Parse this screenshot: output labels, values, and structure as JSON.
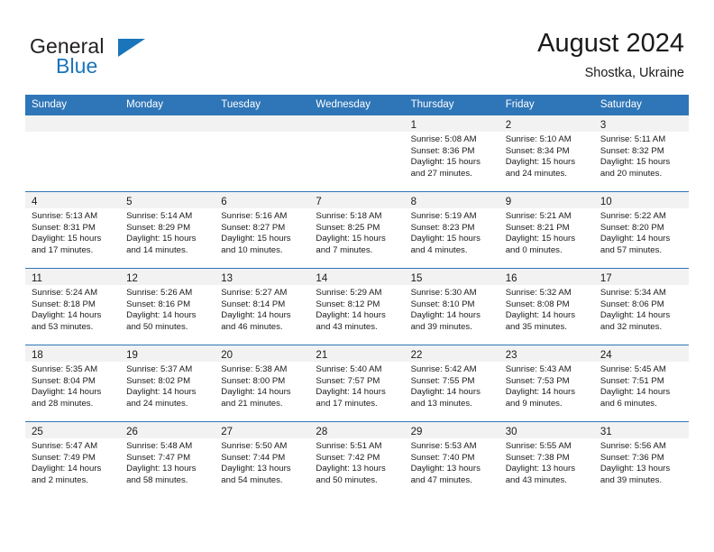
{
  "brand": {
    "word1": "General",
    "word2": "Blue",
    "colors": {
      "dark": "#231f20",
      "blue": "#1b75bb"
    }
  },
  "header": {
    "title": "August 2024",
    "subtitle": "Shostka, Ukraine"
  },
  "calendar": {
    "accent_color": "#2f76b8",
    "daynum_bg": "#f2f2f2",
    "weekday_headers": [
      "Sunday",
      "Monday",
      "Tuesday",
      "Wednesday",
      "Thursday",
      "Friday",
      "Saturday"
    ],
    "weeks": [
      [
        {
          "day": "",
          "lines": []
        },
        {
          "day": "",
          "lines": []
        },
        {
          "day": "",
          "lines": []
        },
        {
          "day": "",
          "lines": []
        },
        {
          "day": "1",
          "lines": [
            "Sunrise: 5:08 AM",
            "Sunset: 8:36 PM",
            "Daylight: 15 hours",
            "and 27 minutes."
          ]
        },
        {
          "day": "2",
          "lines": [
            "Sunrise: 5:10 AM",
            "Sunset: 8:34 PM",
            "Daylight: 15 hours",
            "and 24 minutes."
          ]
        },
        {
          "day": "3",
          "lines": [
            "Sunrise: 5:11 AM",
            "Sunset: 8:32 PM",
            "Daylight: 15 hours",
            "and 20 minutes."
          ]
        }
      ],
      [
        {
          "day": "4",
          "lines": [
            "Sunrise: 5:13 AM",
            "Sunset: 8:31 PM",
            "Daylight: 15 hours",
            "and 17 minutes."
          ]
        },
        {
          "day": "5",
          "lines": [
            "Sunrise: 5:14 AM",
            "Sunset: 8:29 PM",
            "Daylight: 15 hours",
            "and 14 minutes."
          ]
        },
        {
          "day": "6",
          "lines": [
            "Sunrise: 5:16 AM",
            "Sunset: 8:27 PM",
            "Daylight: 15 hours",
            "and 10 minutes."
          ]
        },
        {
          "day": "7",
          "lines": [
            "Sunrise: 5:18 AM",
            "Sunset: 8:25 PM",
            "Daylight: 15 hours",
            "and 7 minutes."
          ]
        },
        {
          "day": "8",
          "lines": [
            "Sunrise: 5:19 AM",
            "Sunset: 8:23 PM",
            "Daylight: 15 hours",
            "and 4 minutes."
          ]
        },
        {
          "day": "9",
          "lines": [
            "Sunrise: 5:21 AM",
            "Sunset: 8:21 PM",
            "Daylight: 15 hours",
            "and 0 minutes."
          ]
        },
        {
          "day": "10",
          "lines": [
            "Sunrise: 5:22 AM",
            "Sunset: 8:20 PM",
            "Daylight: 14 hours",
            "and 57 minutes."
          ]
        }
      ],
      [
        {
          "day": "11",
          "lines": [
            "Sunrise: 5:24 AM",
            "Sunset: 8:18 PM",
            "Daylight: 14 hours",
            "and 53 minutes."
          ]
        },
        {
          "day": "12",
          "lines": [
            "Sunrise: 5:26 AM",
            "Sunset: 8:16 PM",
            "Daylight: 14 hours",
            "and 50 minutes."
          ]
        },
        {
          "day": "13",
          "lines": [
            "Sunrise: 5:27 AM",
            "Sunset: 8:14 PM",
            "Daylight: 14 hours",
            "and 46 minutes."
          ]
        },
        {
          "day": "14",
          "lines": [
            "Sunrise: 5:29 AM",
            "Sunset: 8:12 PM",
            "Daylight: 14 hours",
            "and 43 minutes."
          ]
        },
        {
          "day": "15",
          "lines": [
            "Sunrise: 5:30 AM",
            "Sunset: 8:10 PM",
            "Daylight: 14 hours",
            "and 39 minutes."
          ]
        },
        {
          "day": "16",
          "lines": [
            "Sunrise: 5:32 AM",
            "Sunset: 8:08 PM",
            "Daylight: 14 hours",
            "and 35 minutes."
          ]
        },
        {
          "day": "17",
          "lines": [
            "Sunrise: 5:34 AM",
            "Sunset: 8:06 PM",
            "Daylight: 14 hours",
            "and 32 minutes."
          ]
        }
      ],
      [
        {
          "day": "18",
          "lines": [
            "Sunrise: 5:35 AM",
            "Sunset: 8:04 PM",
            "Daylight: 14 hours",
            "and 28 minutes."
          ]
        },
        {
          "day": "19",
          "lines": [
            "Sunrise: 5:37 AM",
            "Sunset: 8:02 PM",
            "Daylight: 14 hours",
            "and 24 minutes."
          ]
        },
        {
          "day": "20",
          "lines": [
            "Sunrise: 5:38 AM",
            "Sunset: 8:00 PM",
            "Daylight: 14 hours",
            "and 21 minutes."
          ]
        },
        {
          "day": "21",
          "lines": [
            "Sunrise: 5:40 AM",
            "Sunset: 7:57 PM",
            "Daylight: 14 hours",
            "and 17 minutes."
          ]
        },
        {
          "day": "22",
          "lines": [
            "Sunrise: 5:42 AM",
            "Sunset: 7:55 PM",
            "Daylight: 14 hours",
            "and 13 minutes."
          ]
        },
        {
          "day": "23",
          "lines": [
            "Sunrise: 5:43 AM",
            "Sunset: 7:53 PM",
            "Daylight: 14 hours",
            "and 9 minutes."
          ]
        },
        {
          "day": "24",
          "lines": [
            "Sunrise: 5:45 AM",
            "Sunset: 7:51 PM",
            "Daylight: 14 hours",
            "and 6 minutes."
          ]
        }
      ],
      [
        {
          "day": "25",
          "lines": [
            "Sunrise: 5:47 AM",
            "Sunset: 7:49 PM",
            "Daylight: 14 hours",
            "and 2 minutes."
          ]
        },
        {
          "day": "26",
          "lines": [
            "Sunrise: 5:48 AM",
            "Sunset: 7:47 PM",
            "Daylight: 13 hours",
            "and 58 minutes."
          ]
        },
        {
          "day": "27",
          "lines": [
            "Sunrise: 5:50 AM",
            "Sunset: 7:44 PM",
            "Daylight: 13 hours",
            "and 54 minutes."
          ]
        },
        {
          "day": "28",
          "lines": [
            "Sunrise: 5:51 AM",
            "Sunset: 7:42 PM",
            "Daylight: 13 hours",
            "and 50 minutes."
          ]
        },
        {
          "day": "29",
          "lines": [
            "Sunrise: 5:53 AM",
            "Sunset: 7:40 PM",
            "Daylight: 13 hours",
            "and 47 minutes."
          ]
        },
        {
          "day": "30",
          "lines": [
            "Sunrise: 5:55 AM",
            "Sunset: 7:38 PM",
            "Daylight: 13 hours",
            "and 43 minutes."
          ]
        },
        {
          "day": "31",
          "lines": [
            "Sunrise: 5:56 AM",
            "Sunset: 7:36 PM",
            "Daylight: 13 hours",
            "and 39 minutes."
          ]
        }
      ]
    ]
  }
}
